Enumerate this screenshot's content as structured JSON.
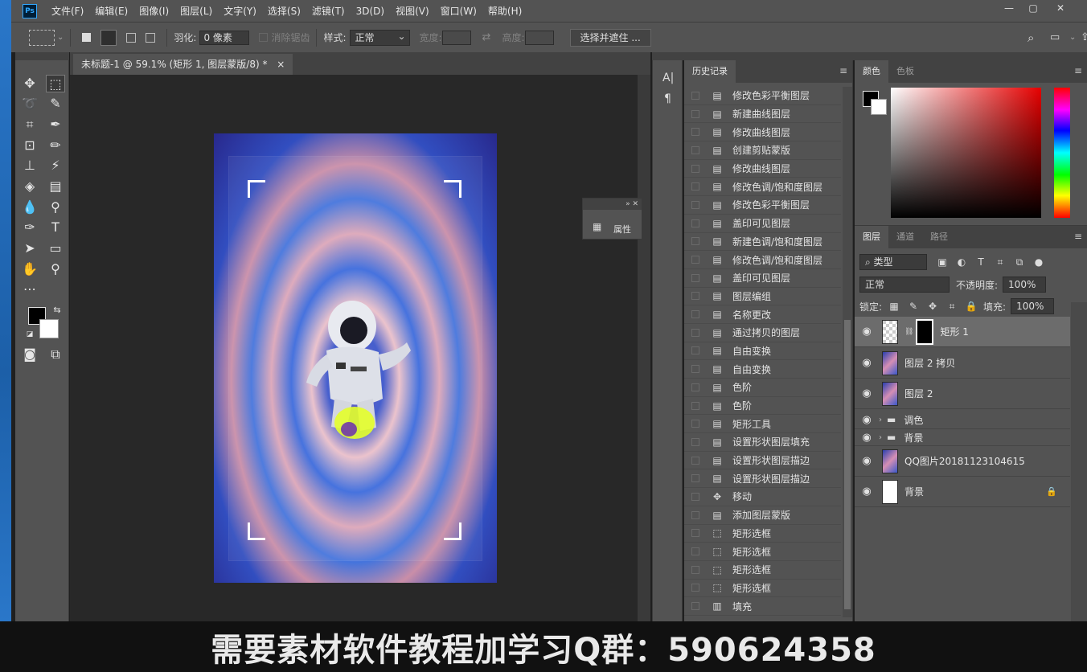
{
  "app": {
    "logo": "Ps",
    "menu": [
      "文件(F)",
      "编辑(E)",
      "图像(I)",
      "图层(L)",
      "文字(Y)",
      "选择(S)",
      "滤镜(T)",
      "3D(D)",
      "视图(V)",
      "窗口(W)",
      "帮助(H)"
    ]
  },
  "options_bar": {
    "feather_label": "羽化:",
    "feather_value": "0 像素",
    "antialias_label": "消除锯齿",
    "style_label": "样式:",
    "style_value": "正常",
    "width_label": "宽度:",
    "height_label": "高度:",
    "select_mask_button": "选择并遮住 ..."
  },
  "document": {
    "tab_title": "未标题-1 @ 59.1% (矩形 1, 图层蒙版/8) *",
    "tab_close": "×"
  },
  "properties_panel": {
    "title": "属性"
  },
  "history": {
    "tab": "历史记录",
    "items": [
      {
        "label": "修改色彩平衡图层",
        "icon": "document-icon"
      },
      {
        "label": "新建曲线图层",
        "icon": "document-icon"
      },
      {
        "label": "修改曲线图层",
        "icon": "document-icon"
      },
      {
        "label": "创建剪贴蒙版",
        "icon": "document-icon"
      },
      {
        "label": "修改曲线图层",
        "icon": "document-icon"
      },
      {
        "label": "修改色调/饱和度图层",
        "icon": "document-icon"
      },
      {
        "label": "修改色彩平衡图层",
        "icon": "document-icon"
      },
      {
        "label": "盖印可见图层",
        "icon": "document-icon"
      },
      {
        "label": "新建色调/饱和度图层",
        "icon": "document-icon"
      },
      {
        "label": "修改色调/饱和度图层",
        "icon": "document-icon"
      },
      {
        "label": "盖印可见图层",
        "icon": "document-icon"
      },
      {
        "label": "图层编组",
        "icon": "document-icon"
      },
      {
        "label": "名称更改",
        "icon": "document-icon"
      },
      {
        "label": "通过拷贝的图层",
        "icon": "document-icon"
      },
      {
        "label": "自由变换",
        "icon": "document-icon"
      },
      {
        "label": "自由变换",
        "icon": "document-icon"
      },
      {
        "label": "色阶",
        "icon": "document-icon"
      },
      {
        "label": "色阶",
        "icon": "document-icon"
      },
      {
        "label": "矩形工具",
        "icon": "document-icon"
      },
      {
        "label": "设置形状图层填充",
        "icon": "document-icon"
      },
      {
        "label": "设置形状图层描边",
        "icon": "document-icon"
      },
      {
        "label": "设置形状图层描边",
        "icon": "document-icon"
      },
      {
        "label": "移动",
        "icon": "move-icon"
      },
      {
        "label": "添加图层蒙版",
        "icon": "document-icon"
      },
      {
        "label": "矩形选框",
        "icon": "marquee-icon"
      },
      {
        "label": "矩形选框",
        "icon": "marquee-icon"
      },
      {
        "label": "矩形选框",
        "icon": "marquee-icon"
      },
      {
        "label": "矩形选框",
        "icon": "marquee-icon"
      },
      {
        "label": "填充",
        "icon": "fill-icon"
      }
    ]
  },
  "color_panel": {
    "tabs": [
      "颜色",
      "色板"
    ]
  },
  "layers_panel": {
    "tabs": [
      "图层",
      "通道",
      "路径"
    ],
    "filter_value": "类型",
    "blend_mode": "正常",
    "opacity_label": "不透明度:",
    "opacity_value": "100%",
    "lock_label": "锁定:",
    "fill_label": "填充:",
    "fill_value": "100%",
    "layers": [
      {
        "name": "矩形 1",
        "type": "shape-with-mask",
        "selected": true
      },
      {
        "name": "图层 2 拷贝",
        "type": "image"
      },
      {
        "name": "图层 2",
        "type": "image"
      },
      {
        "name": "调色",
        "type": "group"
      },
      {
        "name": "背景",
        "type": "group"
      },
      {
        "name": "QQ图片20181123104615",
        "type": "image"
      },
      {
        "name": "背景",
        "type": "background",
        "locked": true
      }
    ]
  },
  "caption": "需要素材软件教程加学习Q群：590624358",
  "colors": {
    "panel": "#535353",
    "canvas_bg": "#282828",
    "accent_blue": "#31a8ff"
  }
}
